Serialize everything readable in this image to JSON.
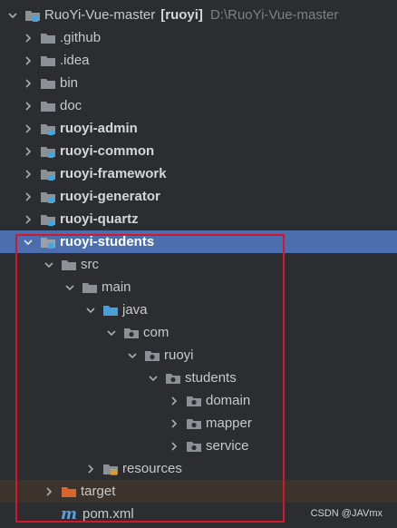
{
  "project_tree": {
    "root": {
      "name": "RuoYi-Vue-master",
      "module": "[ruoyi]",
      "path": "D:\\RuoYi-Vue-master"
    },
    "items": [
      {
        "label": ".github",
        "icon": "folder-icon"
      },
      {
        "label": ".idea",
        "icon": "folder-icon"
      },
      {
        "label": "bin",
        "icon": "folder-icon"
      },
      {
        "label": "doc",
        "icon": "folder-icon"
      },
      {
        "label": "ruoyi-admin",
        "icon": "module-folder-icon"
      },
      {
        "label": "ruoyi-common",
        "icon": "module-folder-icon"
      },
      {
        "label": "ruoyi-framework",
        "icon": "module-folder-icon"
      },
      {
        "label": "ruoyi-generator",
        "icon": "module-folder-icon"
      },
      {
        "label": "ruoyi-quartz",
        "icon": "module-folder-icon"
      },
      {
        "label": "ruoyi-students",
        "icon": "module-folder-icon"
      },
      {
        "label": "src",
        "icon": "folder-icon"
      },
      {
        "label": "main",
        "icon": "folder-icon"
      },
      {
        "label": "java",
        "icon": "source-root-icon"
      },
      {
        "label": "com",
        "icon": "package-icon"
      },
      {
        "label": "ruoyi",
        "icon": "package-icon"
      },
      {
        "label": "students",
        "icon": "package-icon"
      },
      {
        "label": "domain",
        "icon": "package-icon"
      },
      {
        "label": "mapper",
        "icon": "package-icon"
      },
      {
        "label": "service",
        "icon": "package-icon"
      },
      {
        "label": "resources",
        "icon": "resources-root-icon"
      },
      {
        "label": "target",
        "icon": "excluded-folder-icon"
      },
      {
        "label": "pom.xml",
        "icon": "maven-icon"
      }
    ]
  },
  "colors": {
    "background": "#2b2d30",
    "selection": "#4b6eaf",
    "excluded_row": "#3b332c",
    "highlight_box": "#d7162e",
    "folder": "#8c9196",
    "source_root": "#4a9fd6",
    "excluded_folder": "#d9662f",
    "module_marker": "#3ea7e6"
  },
  "watermark": "CSDN @JAVmx"
}
